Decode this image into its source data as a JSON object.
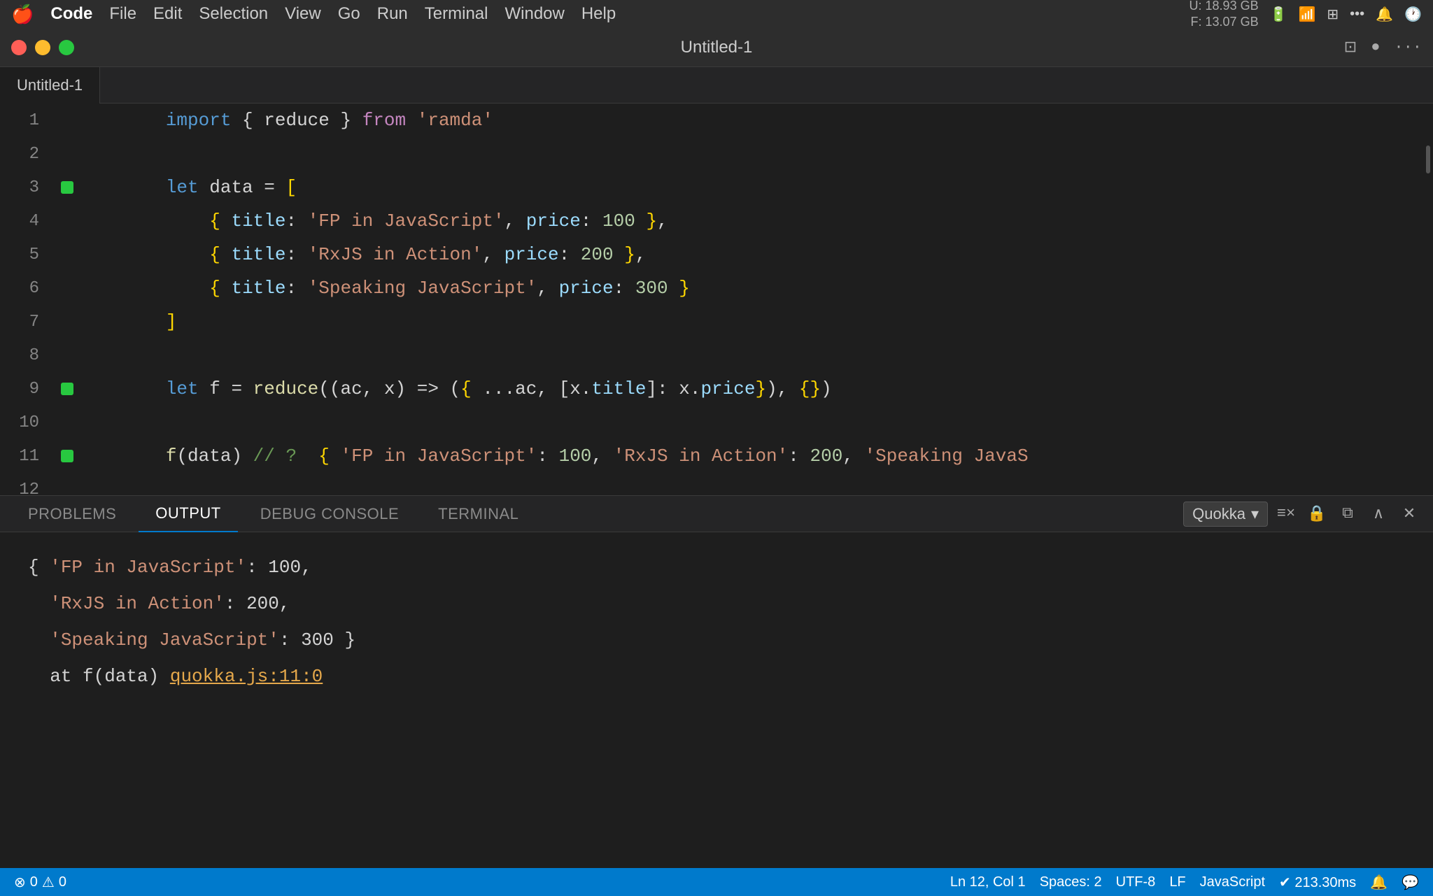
{
  "menubar": {
    "apple": "🍎",
    "items": [
      "Code",
      "File",
      "Edit",
      "Selection",
      "View",
      "Go",
      "Run",
      "Terminal",
      "Window",
      "Help"
    ],
    "bold_index": 0,
    "stats": {
      "u": "U:  18.93 GB",
      "f": "F:  13.07 GB"
    }
  },
  "titlebar": {
    "title": "Untitled-1",
    "tab_label": "Untitled-1"
  },
  "editor": {
    "lines": [
      {
        "num": 1,
        "indicator": false,
        "code": "import { reduce } from 'ramda'"
      },
      {
        "num": 2,
        "indicator": false,
        "code": ""
      },
      {
        "num": 3,
        "indicator": true,
        "code": "let data = ["
      },
      {
        "num": 4,
        "indicator": false,
        "code": "    { title: 'FP in JavaScript', price: 100 },"
      },
      {
        "num": 5,
        "indicator": false,
        "code": "    { title: 'RxJS in Action', price: 200 },"
      },
      {
        "num": 6,
        "indicator": false,
        "code": "    { title: 'Speaking JavaScript', price: 300 }"
      },
      {
        "num": 7,
        "indicator": false,
        "code": "]"
      },
      {
        "num": 8,
        "indicator": false,
        "code": ""
      },
      {
        "num": 9,
        "indicator": true,
        "code": "let f = reduce((ac, x) => ({ ...ac, [x.title]: x.price}), {})"
      },
      {
        "num": 10,
        "indicator": false,
        "code": ""
      },
      {
        "num": 11,
        "indicator": true,
        "code": "f(data) // ?  { 'FP in JavaScript': 100, 'RxJS in Action': 200, 'Speaking JavaS"
      },
      {
        "num": 12,
        "indicator": false,
        "code": ""
      }
    ]
  },
  "panel": {
    "tabs": [
      "PROBLEMS",
      "OUTPUT",
      "DEBUG CONSOLE",
      "TERMINAL"
    ],
    "active_tab": "OUTPUT",
    "dropdown": "Quokka",
    "icons": [
      "≡",
      "🔒",
      "⧉",
      "∧",
      "×"
    ]
  },
  "output": {
    "lines": [
      "{ 'FP in JavaScript': 100,",
      "  'RxJS in Action': 200,",
      "  'Speaking JavaScript': 300 }",
      "  at f(data) quokka.js:11:0"
    ],
    "quokka_link": "quokka.js:11:0"
  },
  "statusbar": {
    "error_count": "0",
    "warning_count": "0",
    "position": "Ln 12, Col 1",
    "spaces": "Spaces: 2",
    "encoding": "UTF-8",
    "eol": "LF",
    "language": "JavaScript",
    "quokka_status": "✔ 213.30ms"
  }
}
